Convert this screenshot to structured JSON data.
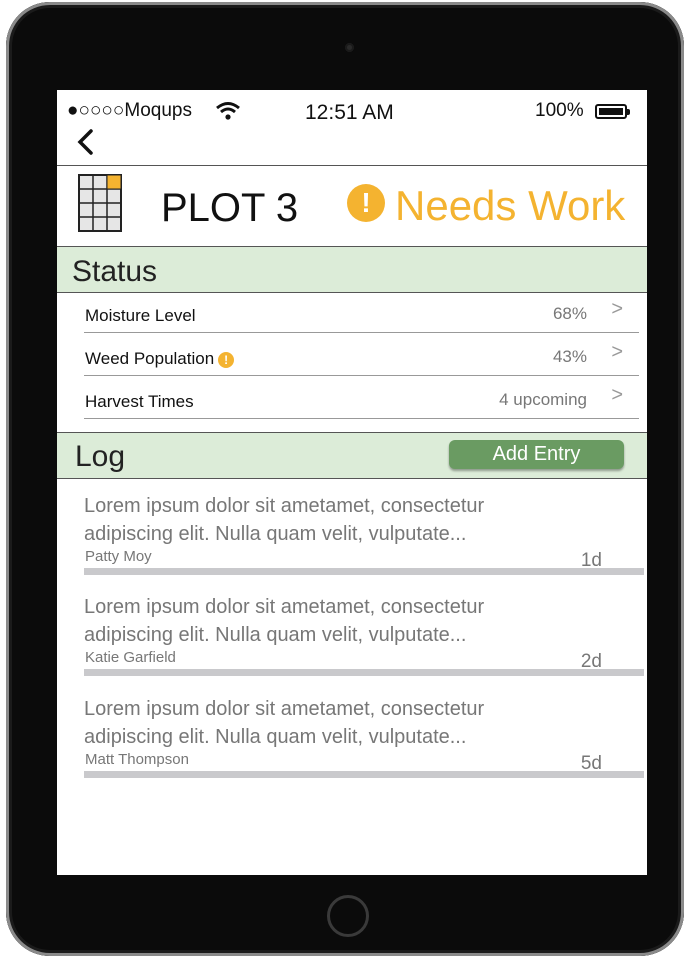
{
  "status_bar": {
    "carrier": "●○○○○Moqups",
    "time": "12:51 AM",
    "battery": "100%"
  },
  "nav": {
    "back_glyph": "<"
  },
  "plot": {
    "title": "PLOT 3",
    "status_label": "Needs Work",
    "status_icon": "!",
    "status_color": "#f4b330"
  },
  "status_section": {
    "title": "Status",
    "items": [
      {
        "label": "Moisture Level",
        "value": "68%",
        "alert": false
      },
      {
        "label": "Weed Population",
        "value": "43%",
        "alert": true
      },
      {
        "label": "Harvest Times",
        "value": "4 upcoming",
        "alert": false
      }
    ]
  },
  "log_section": {
    "title": "Log",
    "add_label": "Add Entry",
    "entries": [
      {
        "text": "Lorem ipsum dolor sit ametamet, consectetur adipiscing elit. Nulla quam velit, vulputate...",
        "author": "Patty Moy",
        "age": "1d"
      },
      {
        "text": "Lorem ipsum dolor sit ametamet, consectetur adipiscing elit. Nulla quam velit, vulputate...",
        "author": "Katie Garfield",
        "age": "2d"
      },
      {
        "text": "Lorem ipsum dolor sit ametamet, consectetur adipiscing elit. Nulla quam velit, vulputate...",
        "author": "Matt Thompson",
        "age": "5d"
      }
    ]
  },
  "colors": {
    "section_bg": "#dcecd8",
    "accent_green": "#6a9b62",
    "warning": "#f4b330"
  },
  "chevron_glyph": ">"
}
